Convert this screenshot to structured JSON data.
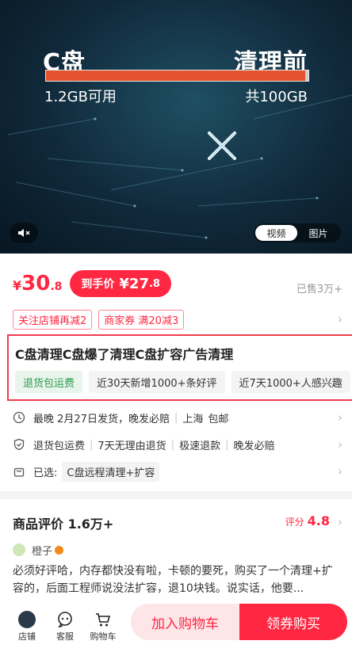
{
  "hero": {
    "left_title": "C盘",
    "right_title": "清理前",
    "usage_fraction": 0.988,
    "available_text": "1.2GB可用",
    "total_text": "共100GB",
    "mute_icon": "mute-icon",
    "media_tabs": [
      "视频",
      "图片"
    ]
  },
  "price": {
    "symbol": "¥",
    "integer": "30",
    "decimal": ".8",
    "hand_label": "到手价",
    "hand_symbol": "¥",
    "hand_integer": "27",
    "hand_decimal": ".8",
    "sold": "已售3万+"
  },
  "coupons": [
    "关注店铺再减2",
    "商家券 满20减3"
  ],
  "product": {
    "title": "C盘清理C盘爆了清理C盘扩容广告清理",
    "tags": [
      "退货包运费",
      "近30天新增1000+条好评",
      "近7天1000+人感兴趣"
    ]
  },
  "shipping": {
    "text": "最晚 2月27日发货，晚发必赔",
    "location": "上海",
    "postage": "包邮"
  },
  "guarantees": [
    "退货包运费",
    "7天无理由退货",
    "极速退款",
    "晚发必赔"
  ],
  "selection": {
    "label": "已选:",
    "value": "C盘远程清理+扩容"
  },
  "reviews": {
    "title": "商品评价 1.6万+",
    "score_label": "评分",
    "score": "4.8",
    "reviewer": "橙子",
    "text": "必须好评哈，内存都快没有啦，卡顿的要死，购买了一个清理+扩容的，后面工程师说没法扩容，退10块钱。说实话，他要..."
  },
  "bottom": {
    "store": "店铺",
    "service": "客服",
    "cart": "购物车",
    "add_cart": "加入购物车",
    "buy": "领券购买"
  },
  "colors": {
    "accent": "#ff2741",
    "green": "#2d9a4c",
    "bar_fill": "#e5532e"
  }
}
